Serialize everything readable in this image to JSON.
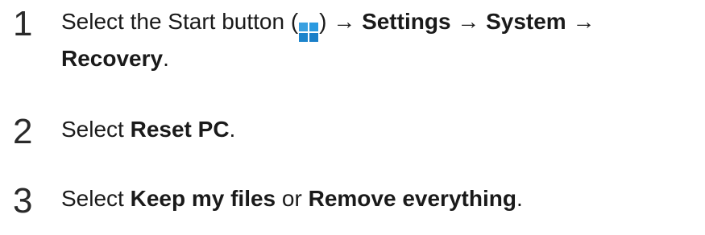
{
  "steps": [
    {
      "number": "1",
      "text_select_start": "Select the Start button (",
      "icon": "windows-start-icon",
      "text_after_icon": ") → ",
      "settings": "Settings",
      "arrow_1": " → ",
      "system": "System",
      "arrow_2": " →",
      "recovery": "Recovery",
      "end": "."
    },
    {
      "number": "2",
      "text_select": "Select ",
      "reset_pc": "Reset PC",
      "end": "."
    },
    {
      "number": "3",
      "text_select": "Select ",
      "keep_my_files": "Keep my files",
      "or": " or ",
      "remove_everything": "Remove everything",
      "end": "."
    }
  ],
  "colors": {
    "text": "#1a1a1a",
    "windows_icon": "#1e90d8"
  }
}
